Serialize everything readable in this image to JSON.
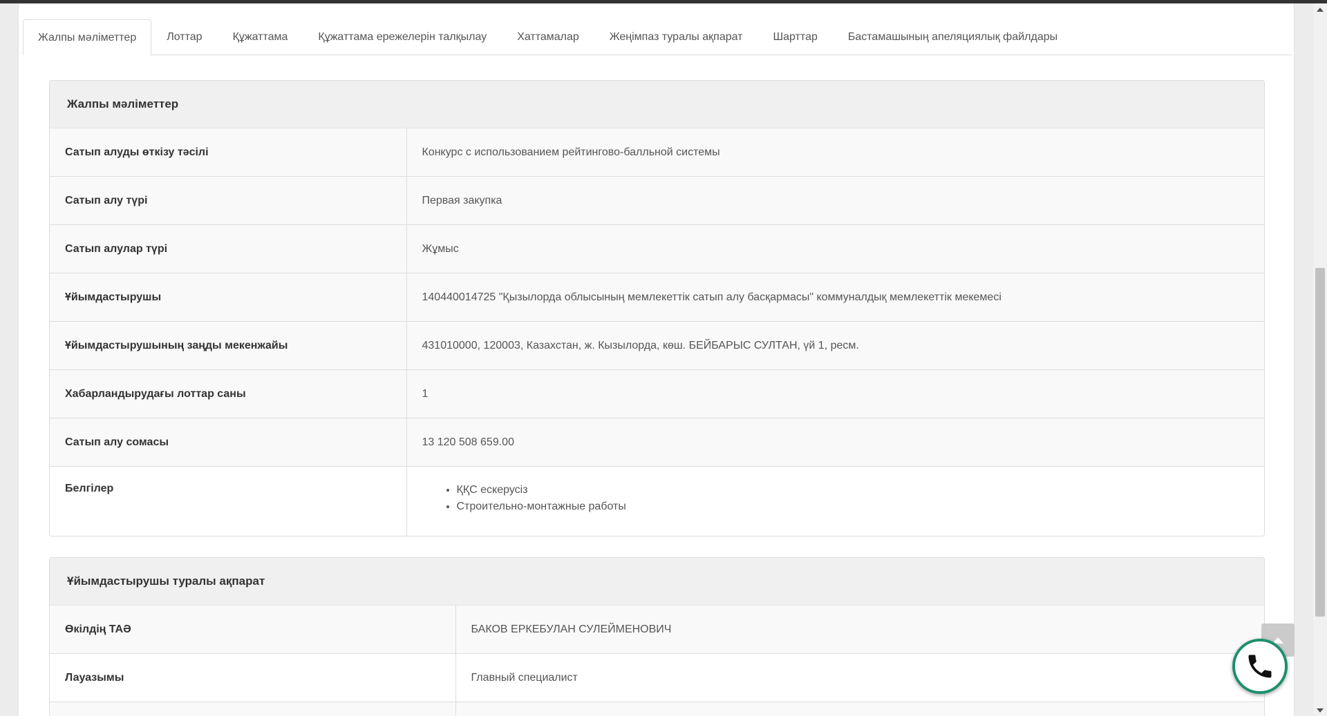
{
  "tabs": [
    {
      "label": "Жалпы мәліметтер",
      "active": true
    },
    {
      "label": "Лоттар"
    },
    {
      "label": "Құжаттама"
    },
    {
      "label": "Құжаттама ережелерін талқылау"
    },
    {
      "label": "Хаттамалар"
    },
    {
      "label": "Жеңімпаз туралы ақпарат"
    },
    {
      "label": "Шарттар"
    },
    {
      "label": "Бастамашының апеляциялық файлдары"
    }
  ],
  "general": {
    "heading": "Жалпы мәліметтер",
    "rows": [
      {
        "label": "Сатып алуды өткізу тәсілі",
        "value": "Конкурс с использованием рейтингово-балльной системы"
      },
      {
        "label": "Сатып алу түрі",
        "value": "Первая закупка"
      },
      {
        "label": "Сатып алулар түрі",
        "value": "Жұмыс"
      },
      {
        "label": "Ұйымдастырушы",
        "value": "140440014725 \"Қызылорда облысының мемлекеттік сатып алу басқармасы\" коммуналдық мемлекеттік мекемесі"
      },
      {
        "label": "Ұйымдастырушының заңды мекенжайы",
        "value": "431010000, 120003, Казахстан, ж. Кызылорда, көш. БЕЙБАРЫС СУЛТАН, үй 1, ресм."
      },
      {
        "label": "Хабарландырудағы лоттар саны",
        "value": "1"
      },
      {
        "label": "Сатып алу сомасы",
        "value": "13 120 508 659.00"
      }
    ],
    "tags_label": "Белгілер",
    "tags": [
      "ҚҚС ескерусіз",
      "Строительно-монтажные работы"
    ]
  },
  "organizer": {
    "heading": "Ұйымдастырушы туралы ақпарат",
    "rows": [
      {
        "label": "Өкілдің ТАӘ",
        "value": "БАКОВ ЕРКЕБУЛАН СУЛЕЙМЕНОВИЧ"
      },
      {
        "label": "Лауазымы",
        "value": "Главный специалист"
      }
    ]
  },
  "colors": {
    "call_ring": "#1e8f6e",
    "header_bg": "#f0f0f0",
    "row_bg": "#f9f9f9"
  },
  "icons": {
    "call": "phone-icon",
    "to_top": "chevron-up-icon"
  }
}
